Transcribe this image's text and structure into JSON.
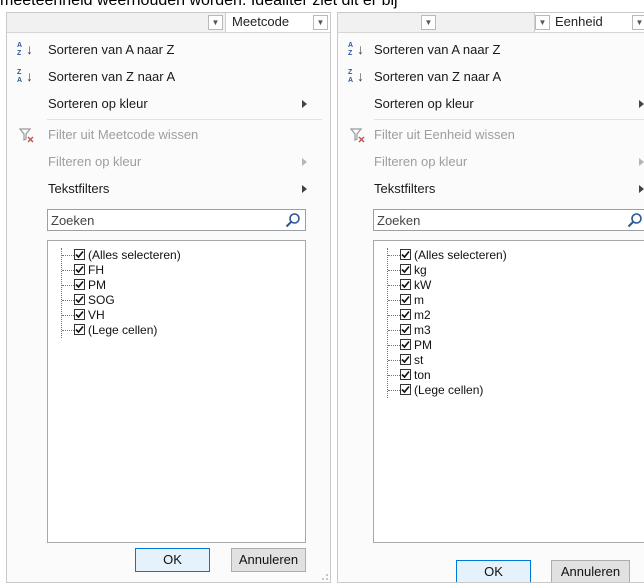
{
  "background_text": "meeteenheid weerhouden worden. Idealiter ziet dit er bij",
  "panel_left": {
    "column_title": "Meetcode",
    "menu": {
      "sort_asc": "Sorteren van A naar Z",
      "sort_desc": "Sorteren van Z naar A",
      "sort_color": "Sorteren op kleur",
      "clear_filter": "Filter uit Meetcode wissen",
      "filter_color": "Filteren op kleur",
      "text_filters": "Tekstfilters"
    },
    "search": {
      "placeholder": "Zoeken"
    },
    "items": [
      "(Alles selecteren)",
      "FH",
      "PM",
      "SOG",
      "VH",
      "(Lege cellen)"
    ],
    "ok_label": "OK",
    "cancel_label": "Annuleren"
  },
  "panel_right": {
    "column_title": "Eenheid",
    "menu": {
      "sort_asc": "Sorteren van A naar Z",
      "sort_desc": "Sorteren van Z naar A",
      "sort_color": "Sorteren op kleur",
      "clear_filter": "Filter uit Eenheid wissen",
      "filter_color": "Filteren op kleur",
      "text_filters": "Tekstfilters"
    },
    "search": {
      "placeholder": "Zoeken"
    },
    "items": [
      "(Alles selecteren)",
      "kg",
      "kW",
      "m",
      "m2",
      "m3",
      "PM",
      "st",
      "ton",
      "(Lege cellen)"
    ],
    "ok_label": "OK",
    "cancel_label": "Annuleren"
  },
  "icons": {
    "dropdown": "chevron-down-icon",
    "sort_asc": "sort-ascending-icon",
    "sort_desc": "sort-descending-icon",
    "clear_filter": "clear-filter-icon",
    "search": "search-icon",
    "submenu": "chevron-right-icon"
  },
  "colors": {
    "ok_border": "#0078d7",
    "ok_fill": "#e5f1fb",
    "disabled_text": "#9e9e9e",
    "sort_letters": "#2b5797"
  }
}
